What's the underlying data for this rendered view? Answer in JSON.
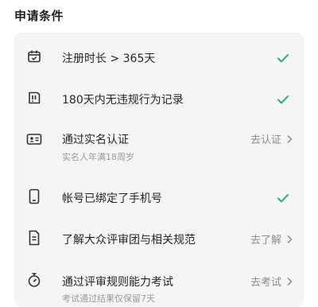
{
  "section_title": "申请条件",
  "colors": {
    "check": "#2aae67",
    "card_bg": "#f5f5f5"
  },
  "items": [
    {
      "icon": "calendar-icon",
      "label": "注册时长 > 365天",
      "status": "done"
    },
    {
      "icon": "violation-record-icon",
      "label": "180天内无违规行为记录",
      "status": "done"
    },
    {
      "icon": "id-card-icon",
      "label": "通过实名认证",
      "sublabel": "实名人年满18周岁",
      "action": "去认证",
      "status": "todo"
    },
    {
      "icon": "phone-icon",
      "label": "帐号已绑定了手机号",
      "status": "done"
    },
    {
      "icon": "document-icon",
      "label": "了解大众评审团与相关规范",
      "action": "去了解",
      "status": "todo"
    },
    {
      "icon": "stopwatch-icon",
      "label": "通过评审规则能力考试",
      "sublabel": "考试通过结果仅保留7天",
      "action": "去考试",
      "status": "todo"
    }
  ]
}
